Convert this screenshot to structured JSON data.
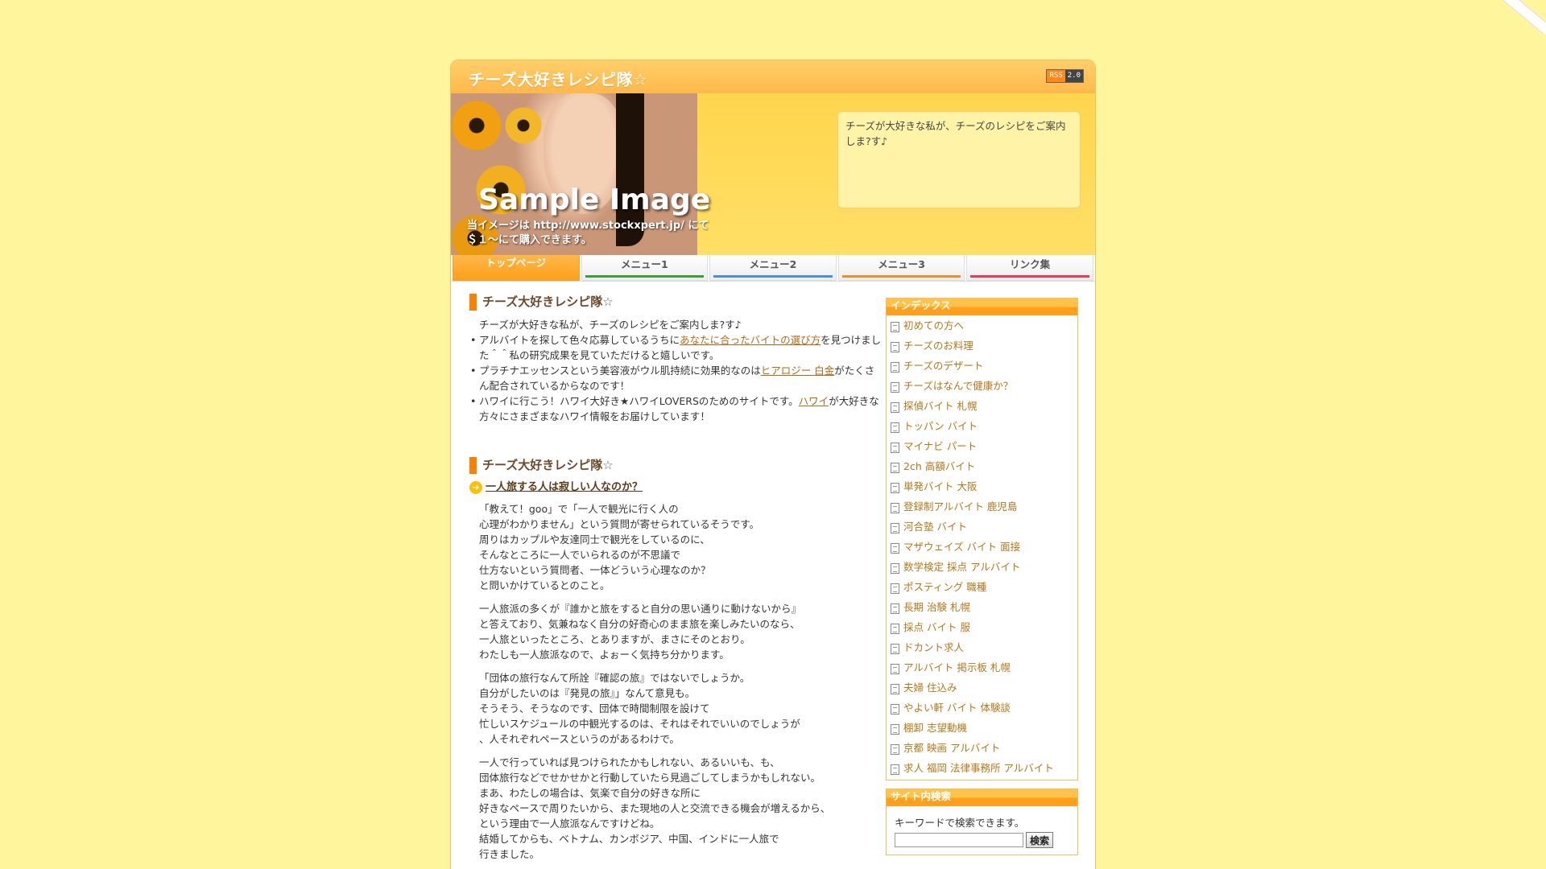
{
  "header": {
    "title": "チーズ大好きレシピ隊☆",
    "rss_label": "RSS",
    "rss_version": "2.0"
  },
  "banner": {
    "sample_text": "Sample Image",
    "caption_line1": "当イメージは http://www.stockxpert.jp/ にて",
    "caption_line2": "＄１〜にて購入できます。",
    "description": "チーズが大好きな私が、チーズのレシピをご案内しま?す♪"
  },
  "nav": {
    "items": [
      {
        "label": "トップページ",
        "color": "#ff9f1a"
      },
      {
        "label": "メニュー1",
        "color": "#3aa03a"
      },
      {
        "label": "メニュー2",
        "color": "#4a90d9"
      },
      {
        "label": "メニュー3",
        "color": "#e8902a"
      },
      {
        "label": "リンク集",
        "color": "#e0405a"
      }
    ]
  },
  "main": {
    "section1": {
      "title": "チーズ大好きレシピ隊",
      "star": "☆",
      "intro": "チーズが大好きな私が、チーズのレシピをご案内しま?す♪",
      "items": [
        {
          "before": "アルバイトを探して色々応募しているうちに",
          "link": "あなたに合ったバイトの選び方",
          "after": "を見つけました＾＾私の研究成果を見ていただけると嬉しいです。"
        },
        {
          "before": "プラチナエッセンスという美容液がウル肌持続に効果的なのは",
          "link": "ヒアロジー 白金",
          "after": "がたくさん配合されているからなのです！"
        },
        {
          "before": "ハワイに行こう！ハワイ大好き★ハワイLOVERSのためのサイトです。",
          "link": "ハワイ",
          "after": "が大好きな方々にさまざまなハワイ情報をお届けしています！"
        }
      ]
    },
    "section2": {
      "title": "チーズ大好きレシピ隊",
      "star": "☆",
      "article_title": "一人旅する人は寂しい人なのか？",
      "paragraphs": [
        "「教えて！goo」で「一人で観光に行く人の\n心理がわかりません」という質問が寄せられているそうです。\n周りはカップルや友達同士で観光をしているのに、\nそんなところに一人でいられるのが不思議で\n仕方ないという質問者、一体どういう心理なのか？\nと問いかけているとのこと。",
        "一人旅派の多くが『誰かと旅をすると自分の思い通りに動けないから』\nと答えており、気兼ねなく自分の好奇心のまま旅を楽しみたいのなら、\n一人旅といったところ、とありますが、まさにそのとおり。\nわたしも一人旅派なので、よぉーく気持ち分かります。",
        "「団体の旅行なんて所詮『確認の旅』ではないでしょうか。\n自分がしたいのは『発見の旅』」なんて意見も。\nそうそう、そうなのです、団体で時間制限を設けて\n忙しいスケジュールの中観光するのは、それはそれでいいのでしょうが\n、人それぞれペースというのがあるわけで。",
        "一人で行っていれば見つけられたかもしれない、あるいいも、も、\n団体旅行などでせかせかと行動していたら見過ごしてしまうかもしれない。\nまあ、わたしの場合は、気楽で自分の好きな所に\n好きなペースで周りたいから、また現地の人と交流できる機会が増えるから、\nという理由で一人旅派なんですけどね。\n結婚してからも、ベトナム、カンボジア、中国、インドに一人旅で\n行きました。"
      ]
    }
  },
  "sidebar": {
    "index_title": "インデックス",
    "index_items": [
      "初めての方へ",
      "チーズのお料理",
      "チーズのデザート",
      "チーズはなんで健康か？",
      "探偵バイト 札幌",
      "トッパン バイト",
      "マイナビ パート",
      "2ch 高額バイト",
      "単発バイト 大阪",
      "登録制アルバイト 鹿児島",
      "河合塾 バイト",
      "マザウェイズ バイト 面接",
      "数学検定 採点 アルバイト",
      "ポスティング 職種",
      "長期 治験 札幌",
      "採点 バイト 服",
      "ドカント求人",
      "アルバイト 掲示板 札幌",
      "夫婦 住込み",
      "やよい軒 バイト 体験談",
      "棚卸 志望動機",
      "京都 映画 アルバイト",
      "求人 福岡 法律事務所 アルバイト"
    ],
    "search_title": "サイト内検索",
    "search_hint": "キーワードで検索できます。",
    "search_value": "",
    "search_button": "検索"
  }
}
